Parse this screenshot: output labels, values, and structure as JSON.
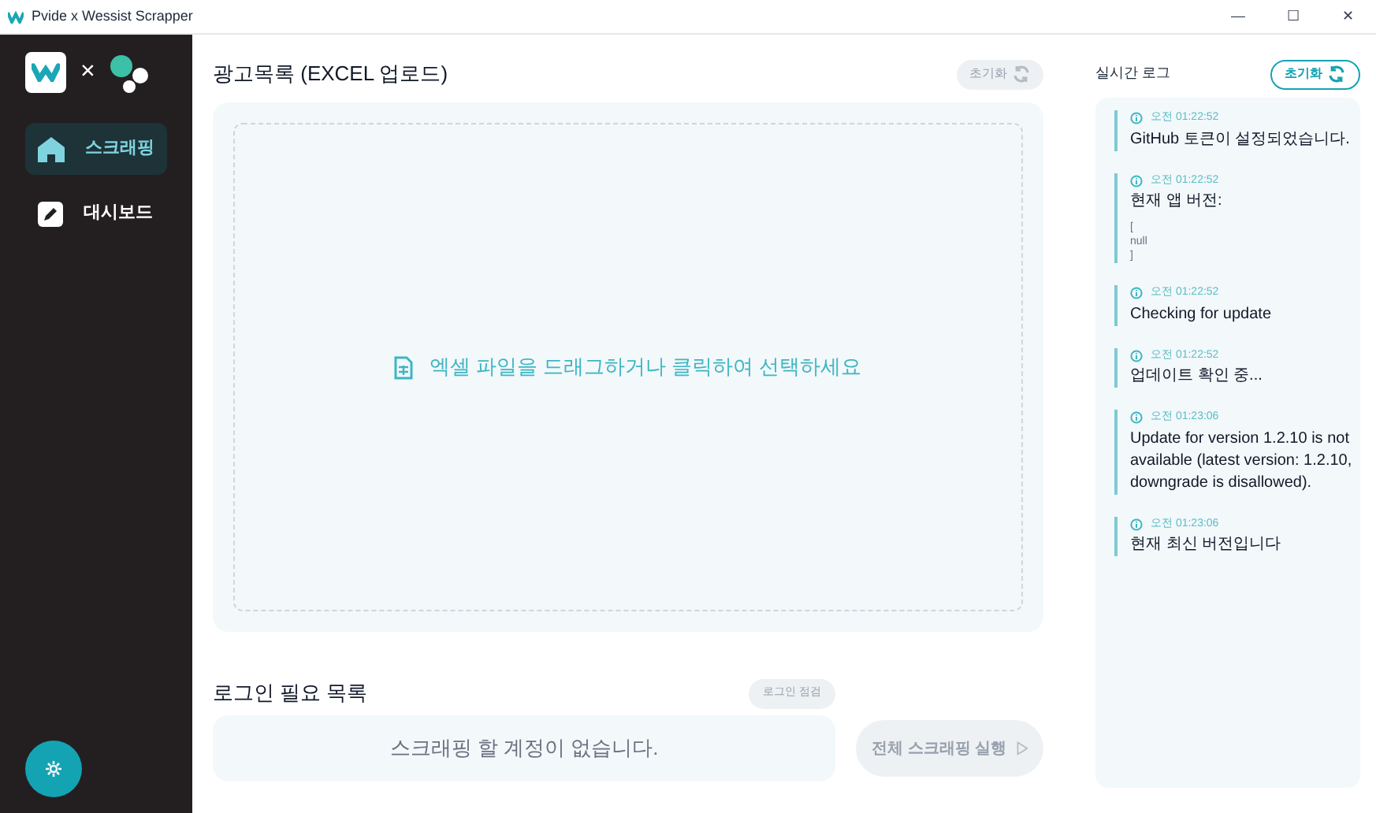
{
  "window": {
    "title": "Pvide x Wessist Scrapper",
    "controls": [
      "—",
      "☐",
      "✕"
    ]
  },
  "sidebar": {
    "logo_separator": "×",
    "items": [
      {
        "label": "스크래핑",
        "kind": "home",
        "selected": true
      },
      {
        "label": "대시보드",
        "kind": "edit",
        "selected": false
      }
    ]
  },
  "upload": {
    "title": "광고목록 (EXCEL 업로드)",
    "reset_button": {
      "label": "초기화",
      "disabled": true
    },
    "dropzone_text": "엑셀 파일을 드래그하거나 클릭하여 선택하세요"
  },
  "login": {
    "title": "로그인 필요 목록",
    "check_button": {
      "label": "로그인 점검",
      "disabled": true
    },
    "empty_text": "스크래핑 할 계정이 없습니다.",
    "run_button": {
      "label": "전체 스크래핑 실행",
      "disabled": true
    }
  },
  "log": {
    "title": "실시간 로그",
    "reset_button": {
      "label": "초기화",
      "disabled": false
    },
    "entries": [
      {
        "time": "오전 01:22:52",
        "message": "GitHub 토큰이 설정되었습니다."
      },
      {
        "time": "오전 01:22:52",
        "message": "현재 앱 버전:",
        "detail": [
          "[",
          "null",
          "]"
        ]
      },
      {
        "time": "오전 01:22:52",
        "message": "Checking for update"
      },
      {
        "time": "오전 01:22:52",
        "message": "업데이트 확인 중..."
      },
      {
        "time": "오전 01:23:06",
        "message": "Update for version 1.2.10 is not available (latest version: 1.2.10, downgrade is disallowed)."
      },
      {
        "time": "오전 01:23:06",
        "message": "현재 최신 버전입니다"
      }
    ]
  }
}
